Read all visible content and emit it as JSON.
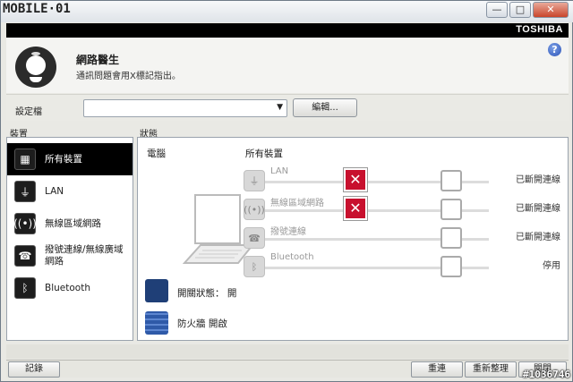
{
  "watermark": {
    "logo_text": "MOBILE·01",
    "stamp": "#1036746"
  },
  "titlebar": {
    "minimize": "—",
    "maximize": "□",
    "close": "✕"
  },
  "brand": "TOSHIBA",
  "header": {
    "title": "網路醫生",
    "description": "通訊問題會用X標記指出。"
  },
  "profile": {
    "label": "設定檔",
    "selected": "",
    "edit_label": "編輯..."
  },
  "sections": {
    "devices": "裝置",
    "status": "狀態"
  },
  "devices": [
    {
      "label": "所有裝置",
      "icon": "chip-icon",
      "selected": true
    },
    {
      "label": "LAN",
      "icon": "lan-plug-icon",
      "selected": false
    },
    {
      "label": "無線區域網路",
      "icon": "wireless-icon",
      "selected": false
    },
    {
      "label": "撥號連線/無線廣域網路",
      "icon": "dialup-icon",
      "selected": false
    },
    {
      "label": "Bluetooth",
      "icon": "bluetooth-icon",
      "selected": false
    }
  ],
  "status": {
    "computer_label": "電腦",
    "all_devices_label": "所有裝置",
    "connections": [
      {
        "name": "LAN",
        "error": true,
        "status": "已斷開連線"
      },
      {
        "name": "無線區域網路",
        "error": true,
        "status": "已斷開連線"
      },
      {
        "name": "撥號連線",
        "error": false,
        "status": "已斷開連線"
      },
      {
        "name": "Bluetooth",
        "error": false,
        "status": "停用"
      }
    ],
    "switch_label": "開關狀態： 開",
    "firewall_label": "防火牆 開啟"
  },
  "footer": {
    "log": "記錄",
    "refresh": "重連",
    "reset": "重新整理",
    "close": "關閉"
  }
}
